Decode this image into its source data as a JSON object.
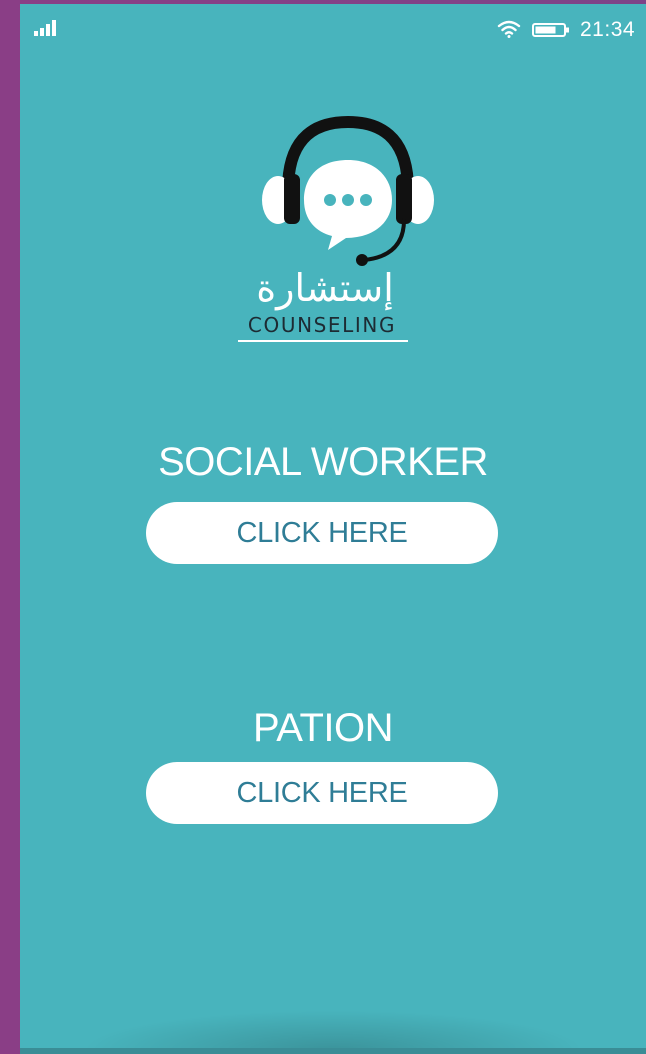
{
  "status_bar": {
    "time": "21:34",
    "icons": [
      "signal-icon",
      "wifi-icon",
      "battery-icon"
    ]
  },
  "logo": {
    "arabic_text": "إستشارة",
    "english_text": "COUNSELING",
    "icon": "headset-chat-icon"
  },
  "options": [
    {
      "title": "SOCIAL WORKER",
      "button_label": "CLICK HERE"
    },
    {
      "title": "PATION",
      "button_label": "CLICK HERE"
    }
  ],
  "colors": {
    "background": "#48b4bd",
    "button_background": "#ffffff",
    "button_text": "#2f7d96",
    "frame": "#853f84"
  }
}
